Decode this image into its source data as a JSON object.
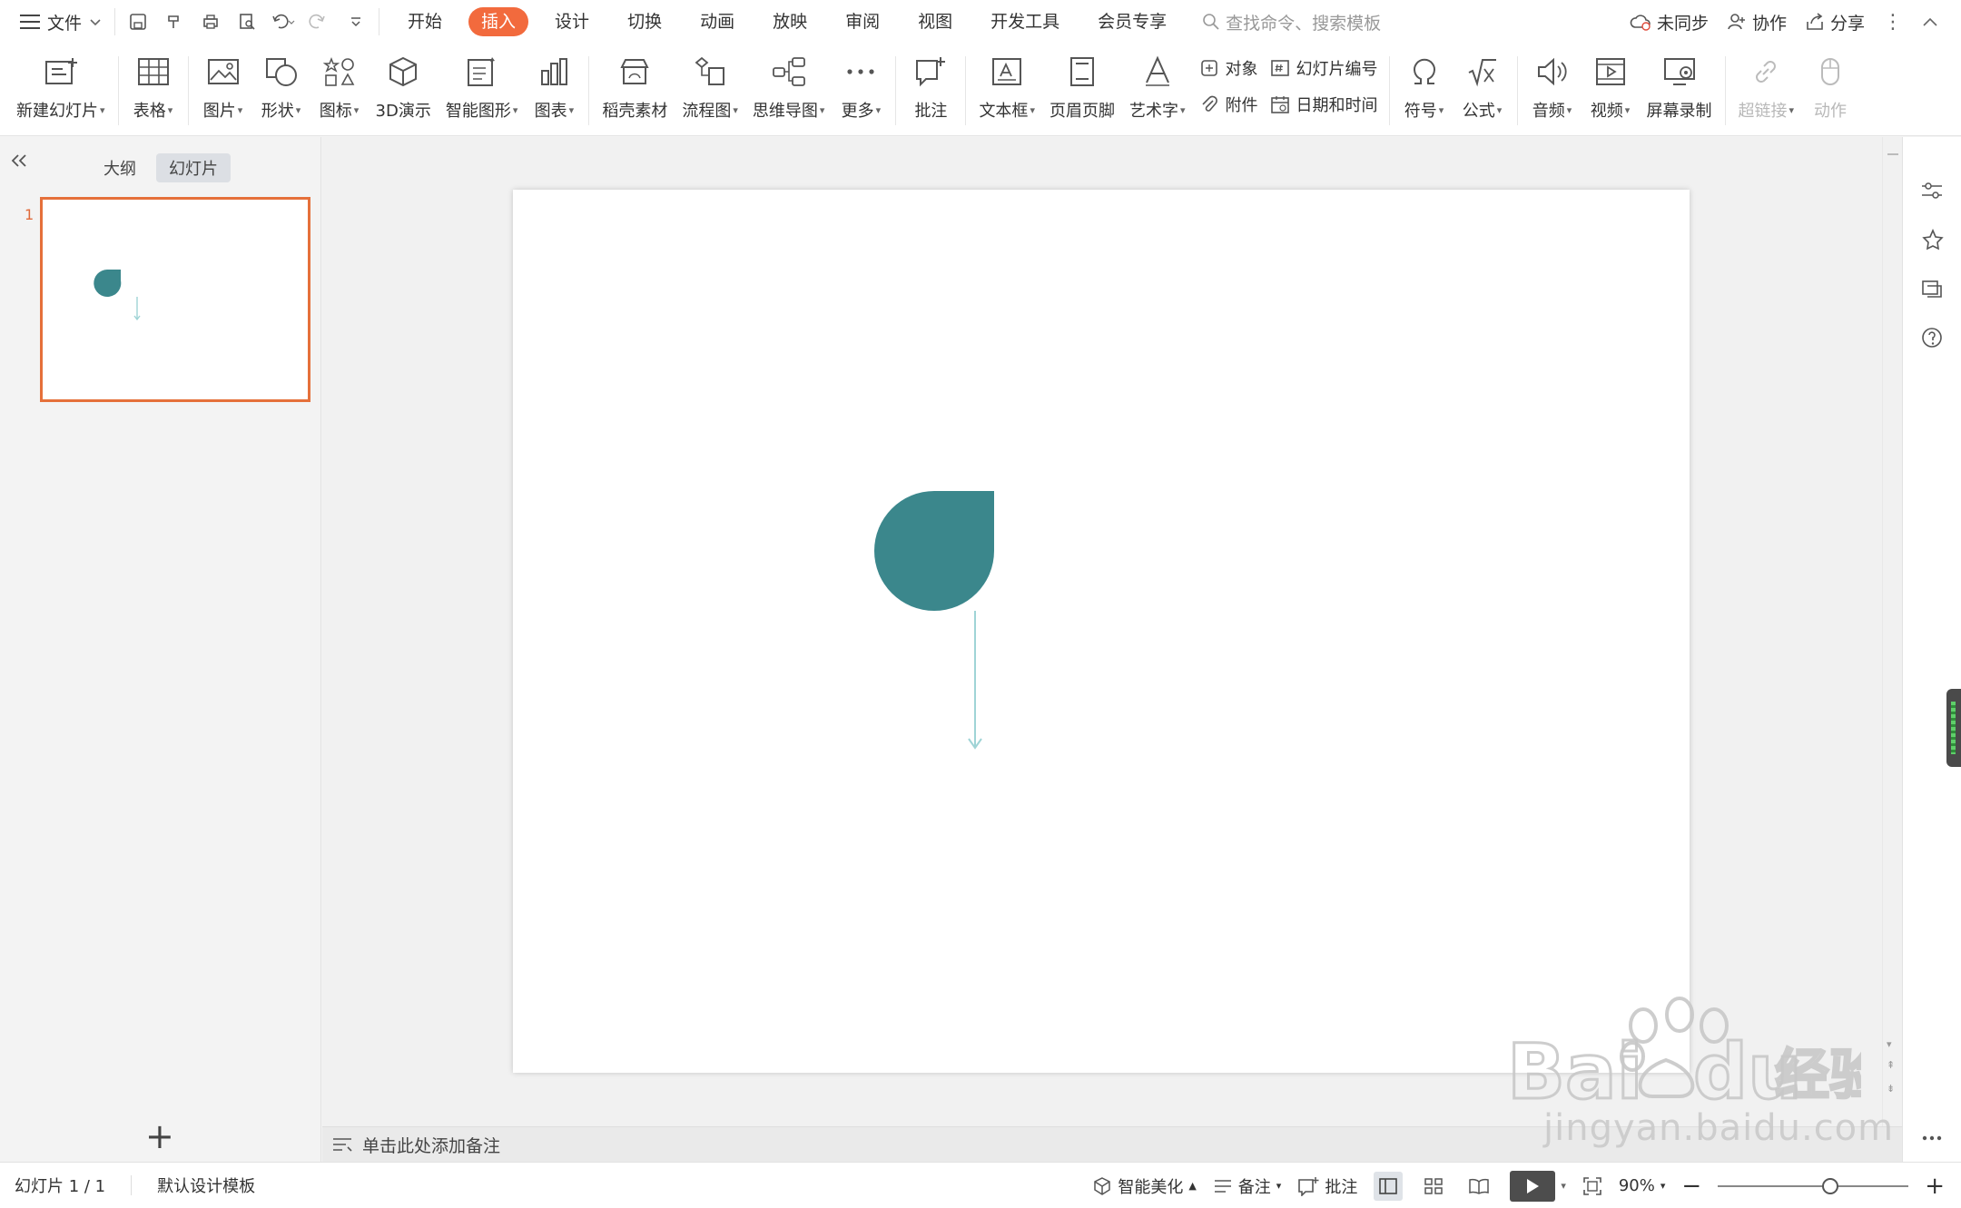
{
  "menubar": {
    "file_label": "文件",
    "tabs": [
      {
        "label": "开始"
      },
      {
        "label": "插入",
        "active": true
      },
      {
        "label": "设计"
      },
      {
        "label": "切换"
      },
      {
        "label": "动画"
      },
      {
        "label": "放映"
      },
      {
        "label": "审阅"
      },
      {
        "label": "视图"
      },
      {
        "label": "开发工具"
      },
      {
        "label": "会员专享"
      }
    ],
    "search_placeholder": "查找命令、搜索模板",
    "right": {
      "sync_label": "未同步",
      "collab_label": "协作",
      "share_label": "分享"
    }
  },
  "ribbon": {
    "new_slide": "新建幻灯片",
    "table": "表格",
    "picture": "图片",
    "shape": "形状",
    "icon": "图标",
    "threed": "3D演示",
    "smartart": "智能图形",
    "chart": "图表",
    "material": "稻壳素材",
    "flowchart": "流程图",
    "mindmap": "思维导图",
    "more": "更多",
    "comment": "批注",
    "textbox": "文本框",
    "header_footer": "页眉页脚",
    "wordart": "艺术字",
    "object": "对象",
    "attachment": "附件",
    "slide_number": "幻灯片编号",
    "date_time": "日期和时间",
    "symbol": "符号",
    "formula": "公式",
    "audio": "音频",
    "video": "视频",
    "screen_record": "屏幕录制",
    "hyperlink": "超链接",
    "action": "动作"
  },
  "leftpanel": {
    "outline_tab": "大纲",
    "slides_tab": "幻灯片",
    "slide_number": "1"
  },
  "slide": {
    "shape_color": "#3b878c",
    "arrow_color": "#9fd4d6"
  },
  "notes": {
    "placeholder": "单击此处添加备注"
  },
  "statusbar": {
    "slide_counter": "幻灯片 1 / 1",
    "template": "默认设计模板",
    "beautify": "智能美化",
    "notes": "备注",
    "comment": "批注",
    "zoom": "90%",
    "zoom_fraction": 0.6
  },
  "watermark": {
    "text": "jingyan.baidu.com"
  },
  "colors": {
    "accent": "#f26a3d",
    "thumb_border": "#e5703a"
  }
}
